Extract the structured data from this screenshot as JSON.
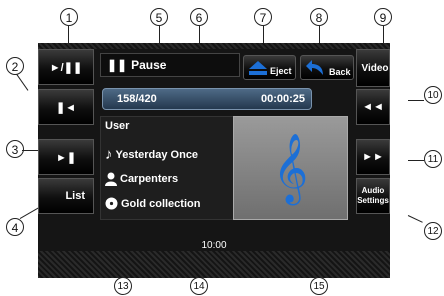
{
  "callouts": [
    "1",
    "2",
    "3",
    "4",
    "5",
    "6",
    "7",
    "8",
    "9",
    "10",
    "11",
    "12",
    "13",
    "14",
    "15"
  ],
  "left_buttons": {
    "play_pause_icon": "play-pause-icon",
    "prev_icon": "prev-track-icon",
    "next_icon": "next-track-icon",
    "list_label": "List"
  },
  "status": {
    "pause_icon": "pause-icon",
    "text": "Pause"
  },
  "eject_label": "Eject",
  "back_label": "Back",
  "right_buttons": {
    "video_label": "Video",
    "rewind_icon": "rewind-icon",
    "fast_forward_icon": "fast-forward-icon",
    "audio_settings_label": "Audio Settings"
  },
  "progress": {
    "track": "158/420",
    "time": "00:00:25"
  },
  "info": {
    "source": "User",
    "title": "Yesterday Once",
    "artist": "Carpenters",
    "album": "Gold collection"
  },
  "clock": "10:00",
  "colors": {
    "accent_blue": "#1c6fd6",
    "treble_clef": "#1c6fd6"
  }
}
